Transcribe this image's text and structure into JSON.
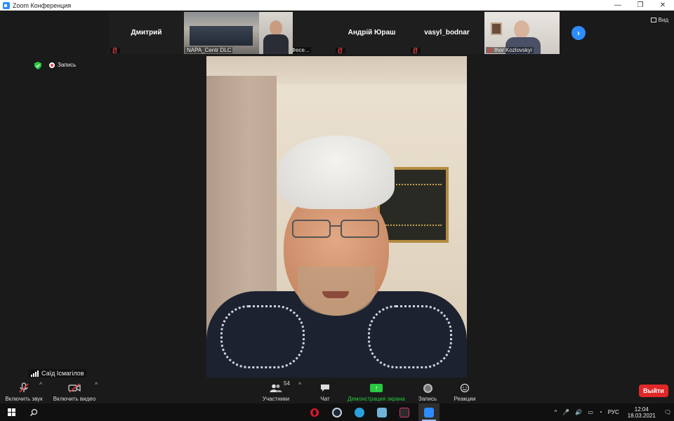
{
  "window": {
    "title": "Zoom Конференция",
    "controls": [
      "—",
      "❐",
      "✕"
    ]
  },
  "gallery": {
    "tiles": [
      {
        "name": "Дмитрий",
        "caption": "",
        "has_video": false
      },
      {
        "name": "",
        "caption": "NAPA_Centr DLC",
        "has_video": true
      },
      {
        "name": "",
        "caption": "Андрей Фесе...",
        "has_video": true
      },
      {
        "name": "Андрій Юраш",
        "caption": "",
        "has_video": false
      },
      {
        "name": "vasyl_bodnar",
        "caption": "",
        "has_video": false
      },
      {
        "name": "",
        "caption": "Ihor Kozlovskyi",
        "has_video": true
      }
    ],
    "view_label": "Вид"
  },
  "recording_indicator": "Запись",
  "active_speaker": {
    "name": "Саїд Ісмагілов"
  },
  "toolbar": {
    "unmute": "Включить звук",
    "start_video": "Включить видео",
    "participants": "Участники",
    "participants_count": "54",
    "chat": "Чат",
    "share": "Демонстрация экрана",
    "record": "Запись",
    "reactions": "Реакции",
    "leave": "Выйти"
  },
  "taskbar": {
    "language": "РУС",
    "time": "12:04",
    "date": "18.03.2021"
  },
  "colors": {
    "accent": "#2d8cff",
    "share_green": "#28c840",
    "leave_red": "#e02828",
    "mute_red": "#e03b3b"
  }
}
